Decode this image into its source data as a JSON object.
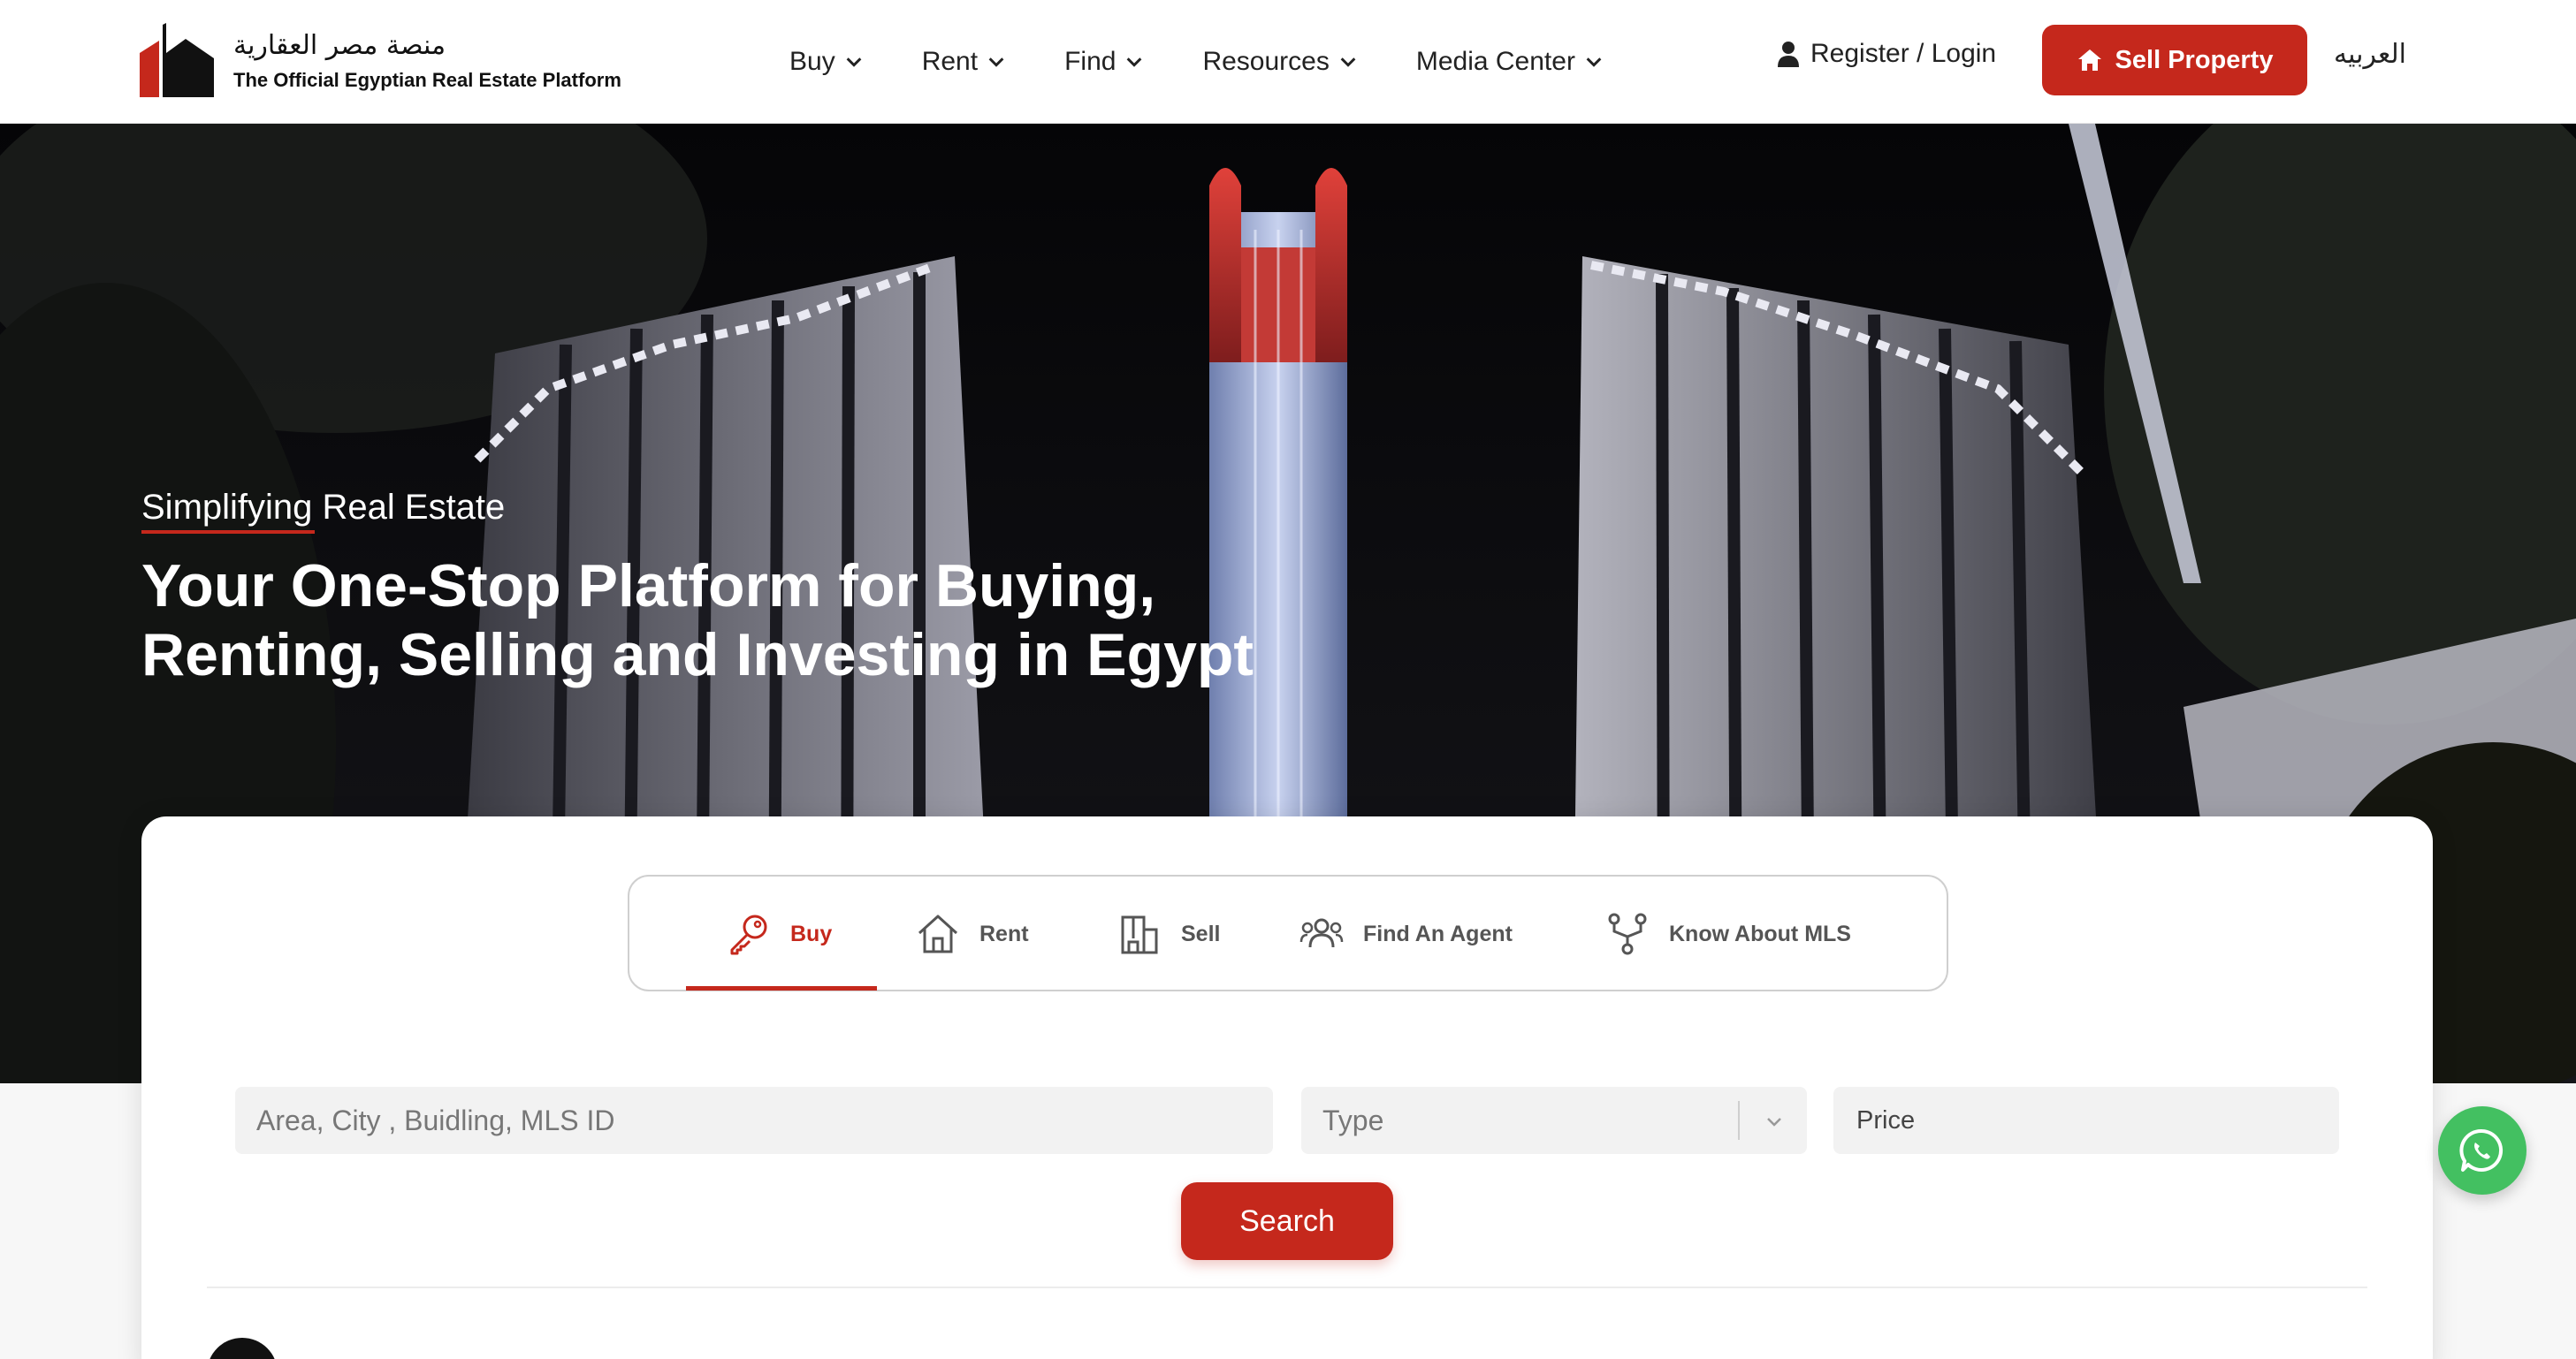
{
  "brand": {
    "name_ar": "منصة مصر العقارية",
    "tagline": "The Official Egyptian Real Estate Platform",
    "accent": "#c5281c"
  },
  "nav": {
    "items": [
      {
        "label": "Buy"
      },
      {
        "label": "Rent"
      },
      {
        "label": "Find"
      },
      {
        "label": "Resources"
      },
      {
        "label": "Media Center"
      }
    ],
    "auth_label": "Register / Login",
    "sell_label": "Sell Property",
    "language_label": "العربيه"
  },
  "hero": {
    "eyebrow": "Simplifying Real Estate",
    "title": "Your One-Stop Platform for Buying, Renting, Selling and Investing in Egypt"
  },
  "search": {
    "tabs": [
      {
        "label": "Buy",
        "icon": "key-icon",
        "active": true
      },
      {
        "label": "Rent",
        "icon": "house-icon",
        "active": false
      },
      {
        "label": "Sell",
        "icon": "building-icon",
        "active": false
      },
      {
        "label": "Find An Agent",
        "icon": "people-icon",
        "active": false
      },
      {
        "label": "Know About MLS",
        "icon": "network-icon",
        "active": false
      }
    ],
    "location_placeholder": "Area, City , Buidling, MLS ID",
    "type_placeholder": "Type",
    "price_placeholder": "Price",
    "search_label": "Search"
  },
  "floating": {
    "whatsapp_color": "#43c061"
  }
}
